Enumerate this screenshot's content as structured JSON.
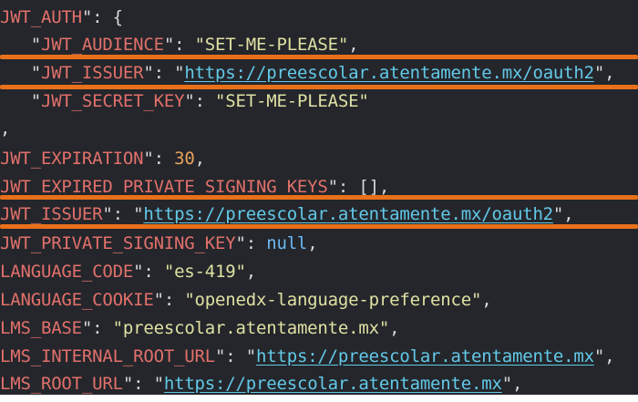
{
  "lines": [
    {
      "parts": [
        {
          "t": "JWT_AUTH",
          "c": "key"
        },
        {
          "t": "\": {",
          "c": "punct"
        }
      ]
    },
    {
      "parts": [
        {
          "t": "   \"",
          "c": "punct"
        },
        {
          "t": "JWT_AUDIENCE",
          "c": "key"
        },
        {
          "t": "\": ",
          "c": "punct"
        },
        {
          "t": "\"SET-ME-PLEASE\"",
          "c": "str"
        },
        {
          "t": ",",
          "c": "punct"
        }
      ]
    },
    {
      "parts": [
        {
          "t": "   \"",
          "c": "punct"
        },
        {
          "t": "JWT_ISSUER",
          "c": "key"
        },
        {
          "t": "\": \"",
          "c": "punct"
        },
        {
          "t": "https://preescolar.atentamente.mx/oauth2",
          "c": "url"
        },
        {
          "t": "\",",
          "c": "punct"
        }
      ]
    },
    {
      "parts": [
        {
          "t": "   \"",
          "c": "punct"
        },
        {
          "t": "JWT_SECRET_KEY",
          "c": "key"
        },
        {
          "t": "\": ",
          "c": "punct"
        },
        {
          "t": "\"SET-ME-PLEASE\"",
          "c": "str"
        }
      ]
    },
    {
      "parts": [
        {
          "t": ",",
          "c": "punct"
        }
      ]
    },
    {
      "parts": [
        {
          "t": "JWT_EXPIRATION",
          "c": "key"
        },
        {
          "t": "\": ",
          "c": "punct"
        },
        {
          "t": "30",
          "c": "num"
        },
        {
          "t": ",",
          "c": "punct"
        }
      ]
    },
    {
      "parts": [
        {
          "t": "JWT_EXPIRED_PRIVATE_SIGNING_KEYS",
          "c": "key"
        },
        {
          "t": "\": [],",
          "c": "punct"
        }
      ]
    },
    {
      "parts": [
        {
          "t": "JWT_ISSUER",
          "c": "key"
        },
        {
          "t": "\": \"",
          "c": "punct"
        },
        {
          "t": "https://preescolar.atentamente.mx/oauth2",
          "c": "url"
        },
        {
          "t": "\",",
          "c": "punct"
        }
      ]
    },
    {
      "parts": [
        {
          "t": "JWT_PRIVATE_SIGNING_KEY",
          "c": "key"
        },
        {
          "t": "\": ",
          "c": "punct"
        },
        {
          "t": "null",
          "c": "kw"
        },
        {
          "t": ",",
          "c": "punct"
        }
      ]
    },
    {
      "parts": [
        {
          "t": "LANGUAGE_CODE",
          "c": "key"
        },
        {
          "t": "\": ",
          "c": "punct"
        },
        {
          "t": "\"es-419\"",
          "c": "str"
        },
        {
          "t": ",",
          "c": "punct"
        }
      ]
    },
    {
      "parts": [
        {
          "t": "LANGUAGE_COOKIE",
          "c": "key"
        },
        {
          "t": "\": ",
          "c": "punct"
        },
        {
          "t": "\"openedx-language-preference\"",
          "c": "str"
        },
        {
          "t": ",",
          "c": "punct"
        }
      ]
    },
    {
      "parts": [
        {
          "t": "LMS_BASE",
          "c": "key"
        },
        {
          "t": "\": ",
          "c": "punct"
        },
        {
          "t": "\"preescolar.atentamente.mx\"",
          "c": "str"
        },
        {
          "t": ",",
          "c": "punct"
        }
      ]
    },
    {
      "parts": [
        {
          "t": "LMS_INTERNAL_ROOT_URL",
          "c": "key"
        },
        {
          "t": "\": \"",
          "c": "punct"
        },
        {
          "t": "https://preescolar.atentamente.mx",
          "c": "url"
        },
        {
          "t": "\",",
          "c": "punct"
        }
      ]
    },
    {
      "parts": [
        {
          "t": "LMS_ROOT_URL",
          "c": "key"
        },
        {
          "t": "\": \"",
          "c": "punct"
        },
        {
          "t": "https://preescolar.atentamente.mx",
          "c": "url"
        },
        {
          "t": "\",",
          "c": "punct"
        }
      ]
    }
  ]
}
